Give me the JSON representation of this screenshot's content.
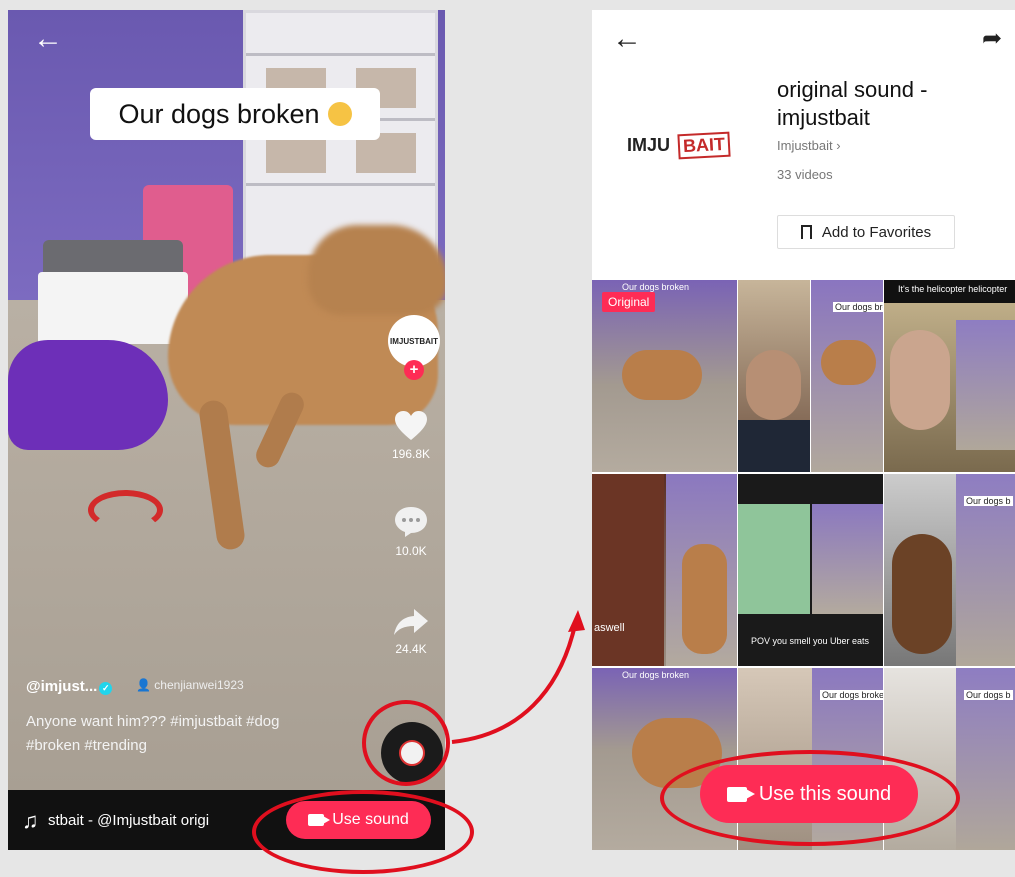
{
  "left_phone": {
    "caption": "Our dogs broken",
    "username": "@imjust...",
    "duet_user": "chenjianwei1923",
    "description": "Anyone want him??? #imjustbait #dog #broken #trending",
    "likes": "196.8K",
    "comments": "10.0K",
    "shares": "24.4K",
    "sound_marquee": "stbait - @Imjustbait   origi",
    "use_sound_label": "Use sound",
    "avatar_text": "IMJUSTBAIT"
  },
  "right_phone": {
    "title": "original sound - imjustbait",
    "author": "Imjustbait ›",
    "video_count": "33 videos",
    "favorites_label": "Add to Favorites",
    "logo_text_left": "IMJU",
    "logo_text_right": "BAIT",
    "original_badge": "Original",
    "use_this_sound_label": "Use this sound",
    "thumbnails": [
      {
        "caption": "Our dogs broken"
      },
      {
        "caption": ""
      },
      {
        "caption": "Our dogs broke"
      },
      {
        "caption": "It's the helicopter helicopter"
      },
      {
        "caption": "Our dogs broke"
      },
      {
        "caption": "aswell"
      },
      {
        "caption": "POV you smell you Uber eats"
      },
      {
        "caption": "Our dogs b"
      },
      {
        "caption": "Our dogs broken"
      },
      {
        "caption": "Our dogs broke"
      },
      {
        "caption": "Our dogs b"
      }
    ]
  },
  "colors": {
    "accent": "#fe2c55",
    "annotation": "#e00f1e"
  },
  "icons": [
    "back-arrow-icon",
    "heart-icon",
    "comment-icon",
    "share-icon",
    "music-note-icon",
    "camera-icon",
    "bookmark-icon",
    "share-outline-icon"
  ]
}
